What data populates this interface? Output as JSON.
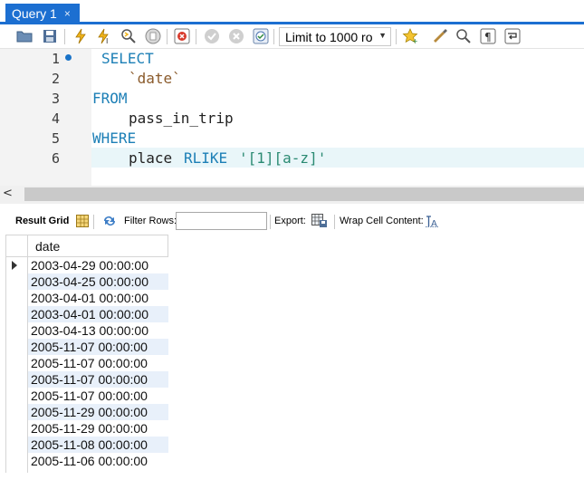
{
  "tab": {
    "title": "Query 1",
    "close": "×"
  },
  "toolbar": {
    "limit_label": "Limit to 1000 ro",
    "icons": [
      "open-folder-icon",
      "save-icon",
      "execute-icon",
      "execute-current-icon",
      "explain-icon",
      "stop-icon",
      "toggle-error-icon",
      "commit-icon",
      "rollback-icon",
      "autocommit-icon",
      "beautify-icon",
      "snippets-icon",
      "find-icon",
      "invisibles-icon",
      "wrap-icon"
    ]
  },
  "editor": {
    "lines": [
      {
        "num": "1",
        "text": "SELECT",
        "marker": true
      },
      {
        "num": "2",
        "text": "`date`"
      },
      {
        "num": "3",
        "text": "FROM"
      },
      {
        "num": "4",
        "text": "pass_in_trip"
      },
      {
        "num": "5",
        "text": "WHERE"
      },
      {
        "num": "6",
        "text_a": "place",
        "text_b": "RLIKE",
        "text_c": "'[1][a-z]'"
      }
    ]
  },
  "result_toolbar": {
    "result_grid": "Result Grid",
    "filter_rows": "Filter Rows:",
    "filter_value": "",
    "export": "Export:",
    "wrap_cell": "Wrap Cell Content:"
  },
  "grid": {
    "column": "date",
    "rows": [
      "2003-04-29 00:00:00",
      "2003-04-25 00:00:00",
      "2003-04-01 00:00:00",
      "2003-04-01 00:00:00",
      "2003-04-13 00:00:00",
      "2005-11-07 00:00:00",
      "2005-11-07 00:00:00",
      "2005-11-07 00:00:00",
      "2005-11-07 00:00:00",
      "2005-11-29 00:00:00",
      "2005-11-29 00:00:00",
      "2005-11-08 00:00:00",
      "2005-11-06 00:00:00"
    ]
  },
  "colors": {
    "accent": "#1c6fd1",
    "keyword": "#1c7fb6",
    "string": "#2a8a72",
    "row_alt": "#e8f0fa"
  }
}
